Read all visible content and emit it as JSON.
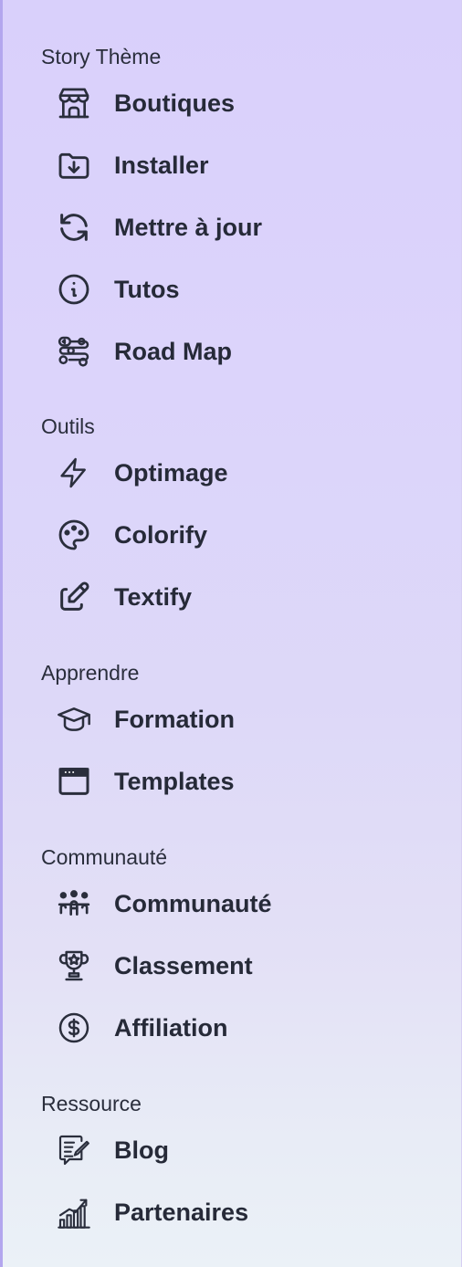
{
  "sections": [
    {
      "title": "Story Thème",
      "items": [
        {
          "label": "Boutiques",
          "icon": "store-icon"
        },
        {
          "label": "Installer",
          "icon": "folder-download-icon"
        },
        {
          "label": "Mettre à jour",
          "icon": "refresh-icon"
        },
        {
          "label": "Tutos",
          "icon": "info-icon"
        },
        {
          "label": "Road Map",
          "icon": "roadmap-icon"
        }
      ]
    },
    {
      "title": "Outils",
      "items": [
        {
          "label": "Optimage",
          "icon": "bolt-icon"
        },
        {
          "label": "Colorify",
          "icon": "palette-icon"
        },
        {
          "label": "Textify",
          "icon": "edit-icon"
        }
      ]
    },
    {
      "title": "Apprendre",
      "items": [
        {
          "label": "Formation",
          "icon": "graduation-cap-icon"
        },
        {
          "label": "Templates",
          "icon": "browser-window-icon"
        }
      ]
    },
    {
      "title": "Communauté",
      "items": [
        {
          "label": "Communauté",
          "icon": "users-group-icon"
        },
        {
          "label": "Classement",
          "icon": "trophy-icon"
        },
        {
          "label": "Affiliation",
          "icon": "dollar-circle-icon"
        }
      ]
    },
    {
      "title": "Ressource",
      "items": [
        {
          "label": "Blog",
          "icon": "blog-icon"
        },
        {
          "label": "Partenaires",
          "icon": "chart-growth-icon"
        }
      ]
    }
  ]
}
